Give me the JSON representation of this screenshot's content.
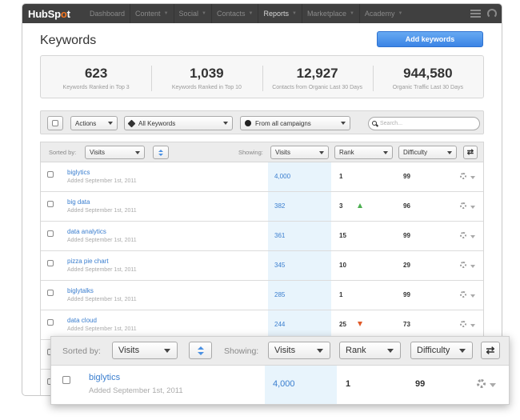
{
  "nav": {
    "brand_prefix": "HubSp",
    "brand_dot": "o",
    "brand_suffix": "t",
    "items": [
      {
        "label": "Dashboard",
        "has_caret": false,
        "active": false
      },
      {
        "label": "Content",
        "has_caret": true,
        "active": false
      },
      {
        "label": "Social",
        "has_caret": true,
        "active": false
      },
      {
        "label": "Contacts",
        "has_caret": true,
        "active": false
      },
      {
        "label": "Reports",
        "has_caret": true,
        "active": true
      },
      {
        "label": "Marketplace",
        "has_caret": true,
        "active": false
      },
      {
        "label": "Academy",
        "has_caret": true,
        "active": false
      }
    ],
    "menu_icon": "hamburger-icon",
    "user_icon": "user-icon"
  },
  "page": {
    "title": "Keywords",
    "add_button": "Add keywords"
  },
  "stats": [
    {
      "value": "623",
      "label": "Keywords Ranked in Top 3"
    },
    {
      "value": "1,039",
      "label": "Keywords Ranked in Top 10"
    },
    {
      "value": "12,927",
      "label": "Contacts from Organic Last 30 Days"
    },
    {
      "value": "944,580",
      "label": "Organic Traffic Last 30 Days"
    }
  ],
  "filters": {
    "actions_label": "Actions",
    "keywords_select": "All Keywords",
    "campaigns_select": "From all campaigns",
    "search_placeholder": "Search..."
  },
  "table": {
    "sorted_by_label": "Sorted by:",
    "sorted_by_value": "Visits",
    "showing_label": "Showing:",
    "columns": [
      "Visits",
      "Rank",
      "Difficulty"
    ],
    "rows": [
      {
        "keyword": "biglytics",
        "added": "Added September 1st, 2011",
        "visits": "4,000",
        "rank": "1",
        "trend": "",
        "difficulty": "99"
      },
      {
        "keyword": "big data",
        "added": "Added September 1st, 2011",
        "visits": "382",
        "rank": "3",
        "trend": "up",
        "difficulty": "96"
      },
      {
        "keyword": "data analytics",
        "added": "Added September 1st, 2011",
        "visits": "361",
        "rank": "15",
        "trend": "",
        "difficulty": "99"
      },
      {
        "keyword": "pizza pie chart",
        "added": "Added September 1st, 2011",
        "visits": "345",
        "rank": "10",
        "trend": "",
        "difficulty": "29"
      },
      {
        "keyword": "biglytalks",
        "added": "Added September 1st, 2011",
        "visits": "285",
        "rank": "1",
        "trend": "",
        "difficulty": "99"
      },
      {
        "keyword": "data cloud",
        "added": "Added September 1st, 2011",
        "visits": "244",
        "rank": "25",
        "trend": "down",
        "difficulty": "73"
      }
    ]
  },
  "zoom": {
    "sorted_by_label": "Sorted by:",
    "sorted_by_value": "Visits",
    "showing_label": "Showing:",
    "columns": [
      "Visits",
      "Rank",
      "Difficulty"
    ],
    "row": {
      "keyword": "biglytics",
      "added": "Added September 1st, 2011",
      "visits": "4,000",
      "rank": "1",
      "difficulty": "99"
    }
  },
  "colors": {
    "nav_bg": "#404040",
    "brand_accent": "#f57722",
    "primary_button": "#3b84e5",
    "link": "#3a7ecf",
    "highlight_column": "#e8f4fc",
    "trend_up": "#4caf50",
    "trend_down": "#e05a28"
  }
}
